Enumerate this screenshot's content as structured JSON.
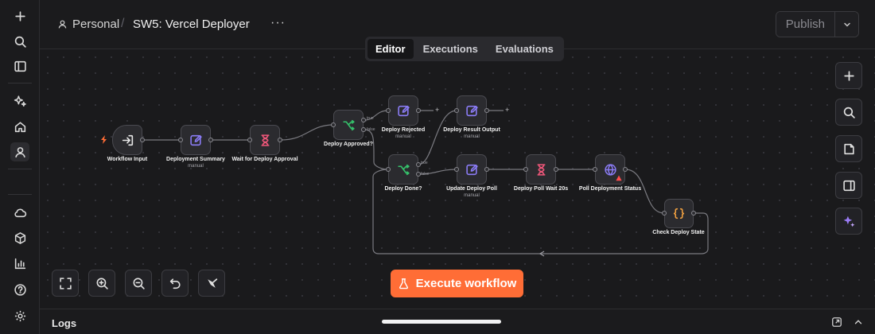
{
  "header": {
    "owner": "Personal",
    "workflow_title": "SW5: Vercel Deployer",
    "more": "···",
    "publish_label": "Publish"
  },
  "tabs": [
    {
      "label": "Editor",
      "active": true
    },
    {
      "label": "Executions",
      "active": false
    },
    {
      "label": "Evaluations",
      "active": false
    }
  ],
  "nodes": [
    {
      "id": "workflow_input",
      "label": "Workflow Input",
      "sub": "",
      "icon": "sign-in-icon"
    },
    {
      "id": "deployment_summary",
      "label": "Deployment Summary",
      "sub": "manual",
      "icon": "edit-icon"
    },
    {
      "id": "wait_approval",
      "label": "Wait for Deploy Approval",
      "sub": "",
      "icon": "hourglass-icon"
    },
    {
      "id": "deploy_approved",
      "label": "Deploy Approved?",
      "sub": "",
      "icon": "if-branch-icon",
      "branches": [
        "true",
        "false"
      ]
    },
    {
      "id": "deploy_rejected",
      "label": "Deploy Rejected",
      "sub": "manual",
      "icon": "edit-icon"
    },
    {
      "id": "deploy_result_output",
      "label": "Deploy Result Output",
      "sub": "manual",
      "icon": "edit-icon"
    },
    {
      "id": "deploy_done",
      "label": "Deploy Done?",
      "sub": "",
      "icon": "if-branch-icon",
      "branches": [
        "true",
        "false"
      ]
    },
    {
      "id": "update_deploy_poll",
      "label": "Update Deploy Poll",
      "sub": "manual",
      "icon": "edit-icon"
    },
    {
      "id": "deploy_poll_wait",
      "label": "Deploy Poll Wait 20s",
      "sub": "",
      "icon": "hourglass-icon"
    },
    {
      "id": "poll_deployment_status",
      "label": "Poll Deployment Status",
      "sub": "",
      "icon": "globe-icon"
    },
    {
      "id": "check_deploy_state",
      "label": "Check Deploy State",
      "sub": "",
      "icon": "code-braces-icon"
    }
  ],
  "execute_label": "Execute workflow",
  "logs_title": "Logs",
  "colors": {
    "accent": "#ff6d36",
    "edit_icon": "#8b7cf6",
    "wait_icon": "#f0577a",
    "if_icon": "#35c26b",
    "http_icon": "#8b7cf6",
    "code_icon": "#f0a040",
    "warning": "#ff4d4d"
  }
}
